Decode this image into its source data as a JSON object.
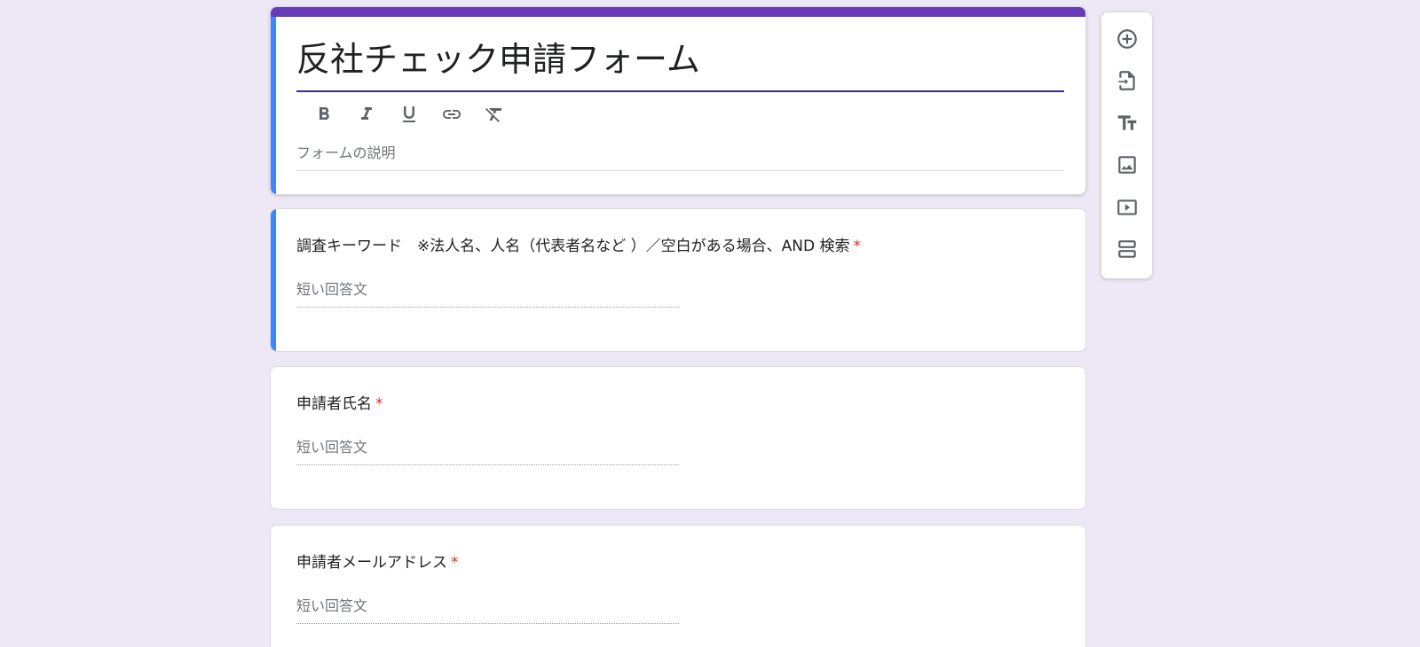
{
  "form": {
    "title": "反社チェック申請フォーム",
    "description_placeholder": "フォームの説明",
    "accent_color": "#673ab7",
    "selected_color": "#4285f4"
  },
  "format_toolbar": [
    {
      "icon": "bold-icon"
    },
    {
      "icon": "italic-icon"
    },
    {
      "icon": "underline-icon"
    },
    {
      "icon": "link-icon"
    },
    {
      "icon": "clear-format-icon"
    }
  ],
  "questions": [
    {
      "label": "調査キーワード　※法人名、人名（代表者名など ）／空白がある場合、AND 検索",
      "required": "*",
      "answer_placeholder": "短い回答文"
    },
    {
      "label": "申請者氏名",
      "required": "*",
      "answer_placeholder": "短い回答文"
    },
    {
      "label": "申請者メールアドレス",
      "required": "*",
      "answer_placeholder": "短い回答文"
    }
  ],
  "side_toolbar": [
    {
      "icon": "add-question-icon"
    },
    {
      "icon": "import-questions-icon"
    },
    {
      "icon": "add-title-icon"
    },
    {
      "icon": "add-image-icon"
    },
    {
      "icon": "add-video-icon"
    },
    {
      "icon": "add-section-icon"
    }
  ]
}
